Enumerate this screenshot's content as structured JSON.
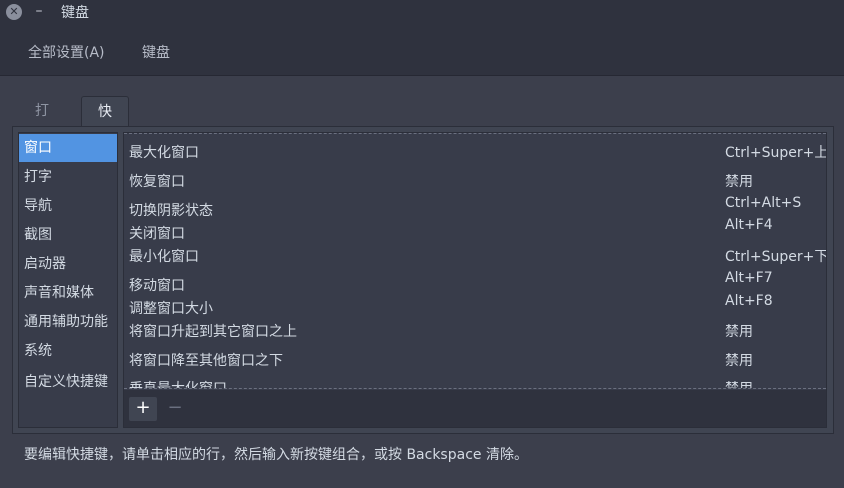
{
  "window": {
    "title": "键盘",
    "close_glyph": "✕",
    "minimize_glyph": "–"
  },
  "nav": {
    "all_settings": "全部设置(A)",
    "current": "键盘"
  },
  "tabs": [
    {
      "label": "打字",
      "active": false
    },
    {
      "label": "快捷键",
      "active": true
    }
  ],
  "categories": [
    {
      "label": "窗口",
      "selected": true
    },
    {
      "label": "打字"
    },
    {
      "label": "导航"
    },
    {
      "label": "截图"
    },
    {
      "label": "启动器"
    },
    {
      "label": "声音和媒体"
    },
    {
      "label": "通用辅助功能"
    },
    {
      "label": "系统"
    },
    {
      "label": "自定义快捷键"
    }
  ],
  "shortcuts": [
    {
      "name": "最大化窗口",
      "key": "Ctrl+Super+上"
    },
    {
      "name": "恢复窗口",
      "key": "禁用"
    },
    {
      "name": "切换阴影状态",
      "key": "Ctrl+Alt+S"
    },
    {
      "name": "关闭窗口",
      "key": "Alt+F4"
    },
    {
      "name": "最小化窗口",
      "key": "Ctrl+Super+下"
    },
    {
      "name": "移动窗口",
      "key": "Alt+F7"
    },
    {
      "name": "调整窗口大小",
      "key": "Alt+F8"
    },
    {
      "name": "将窗口升起到其它窗口之上",
      "key": "禁用"
    },
    {
      "name": "将窗口降至其他窗口之下",
      "key": "禁用"
    },
    {
      "name": "垂直最大化窗口",
      "key": "禁用"
    }
  ],
  "toolbar": {
    "add_glyph": "+",
    "remove_glyph": "−"
  },
  "hint": "要编辑快捷键，请单击相应的行，然后输入新按键组合，或按 Backspace 清除。",
  "colors": {
    "accent": "#5294e2",
    "background": "#3c3f4c",
    "header": "#2f323e"
  }
}
